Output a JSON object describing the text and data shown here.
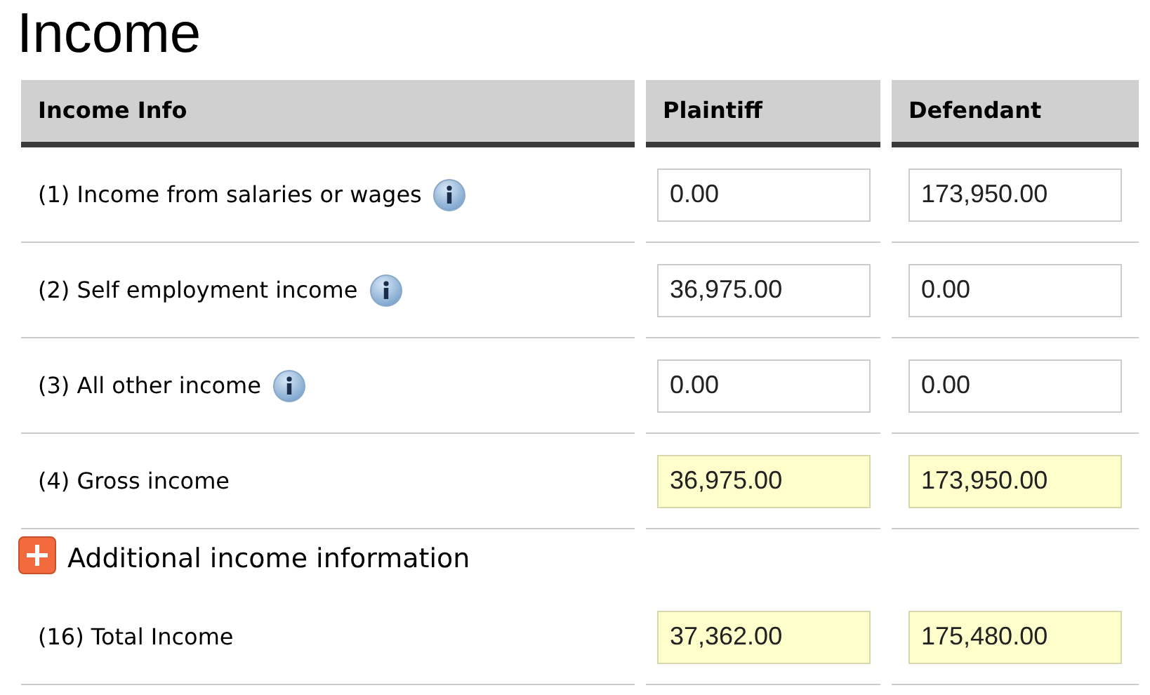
{
  "title": "Income",
  "columns": [
    "Income Info",
    "Plaintiff",
    "Defendant"
  ],
  "rows": [
    {
      "kind": "line",
      "label": "(1) Income from salaries or wages",
      "info": true,
      "plaintiff": {
        "value": "0.00",
        "readonly": false
      },
      "defendant": {
        "value": "173,950.00",
        "readonly": false
      }
    },
    {
      "kind": "line",
      "label": "(2) Self employment income",
      "info": true,
      "plaintiff": {
        "value": "36,975.00",
        "readonly": false
      },
      "defendant": {
        "value": "0.00",
        "readonly": false
      }
    },
    {
      "kind": "line",
      "label": "(3) All other income",
      "info": true,
      "plaintiff": {
        "value": "0.00",
        "readonly": false
      },
      "defendant": {
        "value": "0.00",
        "readonly": false
      }
    },
    {
      "kind": "line",
      "label": "(4) Gross income",
      "info": false,
      "plaintiff": {
        "value": "36,975.00",
        "readonly": true
      },
      "defendant": {
        "value": "173,950.00",
        "readonly": true
      }
    },
    {
      "kind": "toggle",
      "label": "Additional income information",
      "expanded": false
    },
    {
      "kind": "line",
      "label": "(16) Total Income",
      "info": false,
      "plaintiff": {
        "value": "37,362.00",
        "readonly": true
      },
      "defendant": {
        "value": "175,480.00",
        "readonly": true
      }
    }
  ]
}
